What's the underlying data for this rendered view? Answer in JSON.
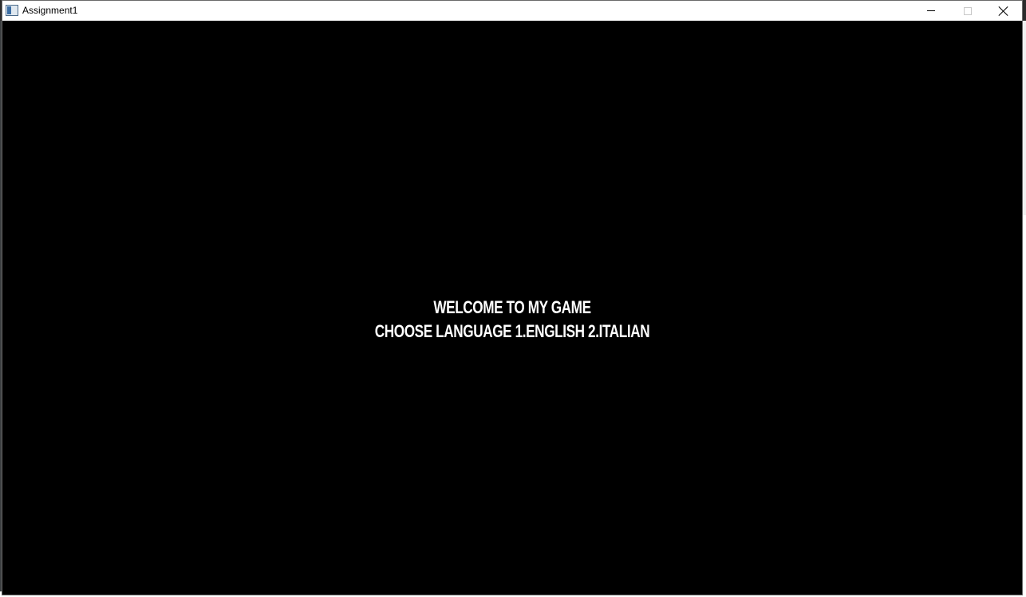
{
  "window": {
    "title": "Assignment1",
    "icon": "app-window-icon",
    "controls": {
      "minimize_icon": "minimize-icon",
      "maximize_icon": "maximize-icon",
      "close_icon": "close-icon"
    }
  },
  "game": {
    "welcome_text": "WELCOME TO MY GAME",
    "language_prompt": "CHOOSE LANGUAGE 1.ENGLISH 2.ITALIAN",
    "background_color": "#000000",
    "text_color": "#ffffff"
  }
}
